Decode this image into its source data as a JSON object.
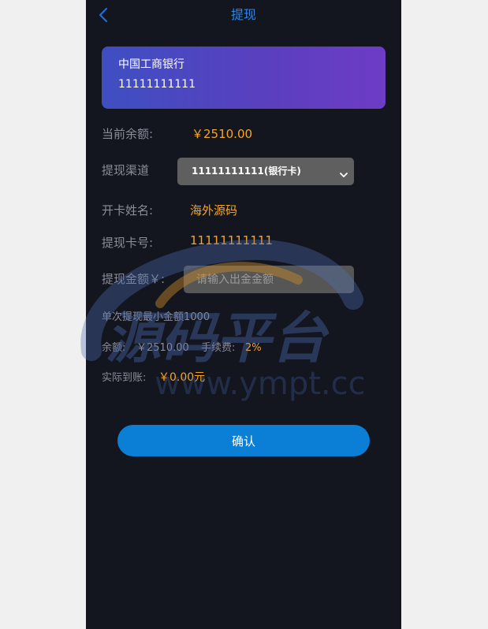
{
  "header": {
    "title": "提现",
    "back_icon": "chevron-left-icon"
  },
  "card": {
    "bank_name": "中国工商银行",
    "card_number": "11111111111"
  },
  "form": {
    "balance_label": "当前余额:",
    "balance_value": "￥2510.00",
    "channel_label": "提现渠道",
    "channel_selected": "11111111111(银行卡)",
    "holder_label": "开卡姓名:",
    "holder_value": "海外源码",
    "card_label": "提现卡号:",
    "card_value": "11111111111",
    "amount_label": "提现金额￥:",
    "amount_placeholder": "请输入出金金额",
    "min_note": "单次提现最小金额1000",
    "remain_label": "余额:",
    "remain_value": "￥2510.00",
    "fee_label": "手续费:",
    "fee_value": "2%",
    "actual_label": "实际到账:",
    "actual_value": "￥0.00元"
  },
  "confirm_label": "确认",
  "watermark": {
    "text_cn": "源码平台",
    "text_url": "www.ympt.cc"
  },
  "colors": {
    "accent": "#0b7fd6",
    "highlight": "#f5a623",
    "background": "#13151f"
  }
}
